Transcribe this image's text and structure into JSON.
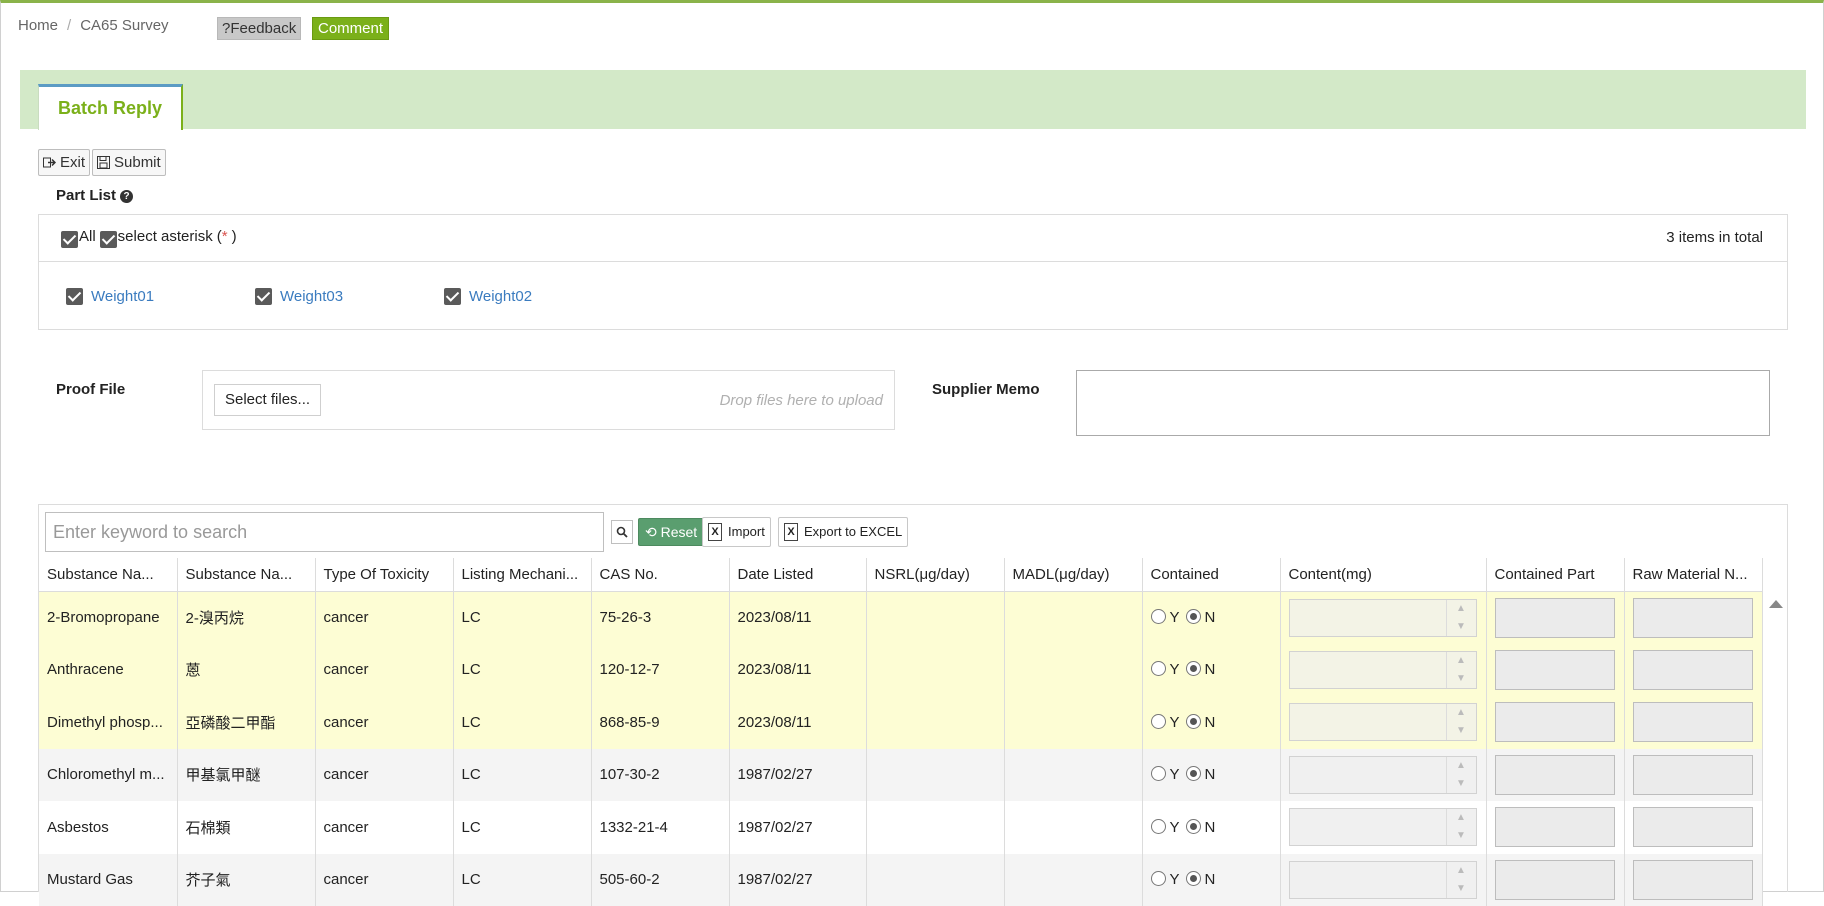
{
  "breadcrumb": {
    "home": "Home",
    "sep": "/",
    "current": "CA65 Survey"
  },
  "header": {
    "feedback_label": "?Feedback",
    "comment_label": "Comment"
  },
  "tabs": {
    "active": "Batch Reply"
  },
  "actions": {
    "exit": "Exit",
    "submit": "Submit"
  },
  "part_list": {
    "title": "Part List",
    "all_label": "All",
    "select_asterisk_label": "select asterisk",
    "asterisk": "*",
    "total": "3 items in total",
    "items": [
      {
        "label": "Weight01",
        "checked": true
      },
      {
        "label": "Weight03",
        "checked": true
      },
      {
        "label": "Weight02",
        "checked": true
      }
    ]
  },
  "proof": {
    "label": "Proof File",
    "select_files": "Select files...",
    "drop_hint": "Drop files here to upload"
  },
  "memo": {
    "label": "Supplier Memo",
    "value": ""
  },
  "toolbar": {
    "search_placeholder": "Enter keyword to search",
    "reset": "Reset",
    "import": "Import",
    "export": "Export to EXCEL"
  },
  "columns": [
    "Substance Na...",
    "Substance Na...",
    "Type Of Toxicity",
    "Listing Mechani...",
    "CAS No.",
    "Date Listed",
    "NSRL(μg/day)",
    "MADL(μg/day)",
    "Contained",
    "Content(mg)",
    "Contained Part",
    "Raw Material N..."
  ],
  "radio": {
    "y": "Y",
    "n": "N"
  },
  "rows": [
    {
      "name_en": "2-Bromopropane",
      "name_zh": "2-溴丙烷",
      "toxicity": "cancer",
      "mechanism": "LC",
      "cas": "75-26-3",
      "date": "2023/08/11",
      "nsrl": "",
      "madl": "",
      "contained": "N"
    },
    {
      "name_en": "Anthracene",
      "name_zh": "蒽",
      "toxicity": "cancer",
      "mechanism": "LC",
      "cas": "120-12-7",
      "date": "2023/08/11",
      "nsrl": "",
      "madl": "",
      "contained": "N"
    },
    {
      "name_en": "Dimethyl phosp...",
      "name_zh": "亞磷酸二甲酯",
      "toxicity": "cancer",
      "mechanism": "LC",
      "cas": "868-85-9",
      "date": "2023/08/11",
      "nsrl": "",
      "madl": "",
      "contained": "N"
    },
    {
      "name_en": "Chloromethyl m...",
      "name_zh": "甲基氯甲醚",
      "toxicity": "cancer",
      "mechanism": "LC",
      "cas": "107-30-2",
      "date": "1987/02/27",
      "nsrl": "",
      "madl": "",
      "contained": "N"
    },
    {
      "name_en": "Asbestos",
      "name_zh": "石棉類",
      "toxicity": "cancer",
      "mechanism": "LC",
      "cas": "1332-21-4",
      "date": "1987/02/27",
      "nsrl": "",
      "madl": "",
      "contained": "N"
    },
    {
      "name_en": "Mustard Gas",
      "name_zh": "芥子氣",
      "toxicity": "cancer",
      "mechanism": "LC",
      "cas": "505-60-2",
      "date": "1987/02/27",
      "nsrl": "",
      "madl": "",
      "contained": "N"
    }
  ],
  "colors": {
    "brand_green": "#7bb01a",
    "tab_band": "#d3e9c8",
    "highlight_row": "#fdfdd4",
    "link_blue": "#3a7bbf",
    "reset_green": "#5a9e6f"
  }
}
